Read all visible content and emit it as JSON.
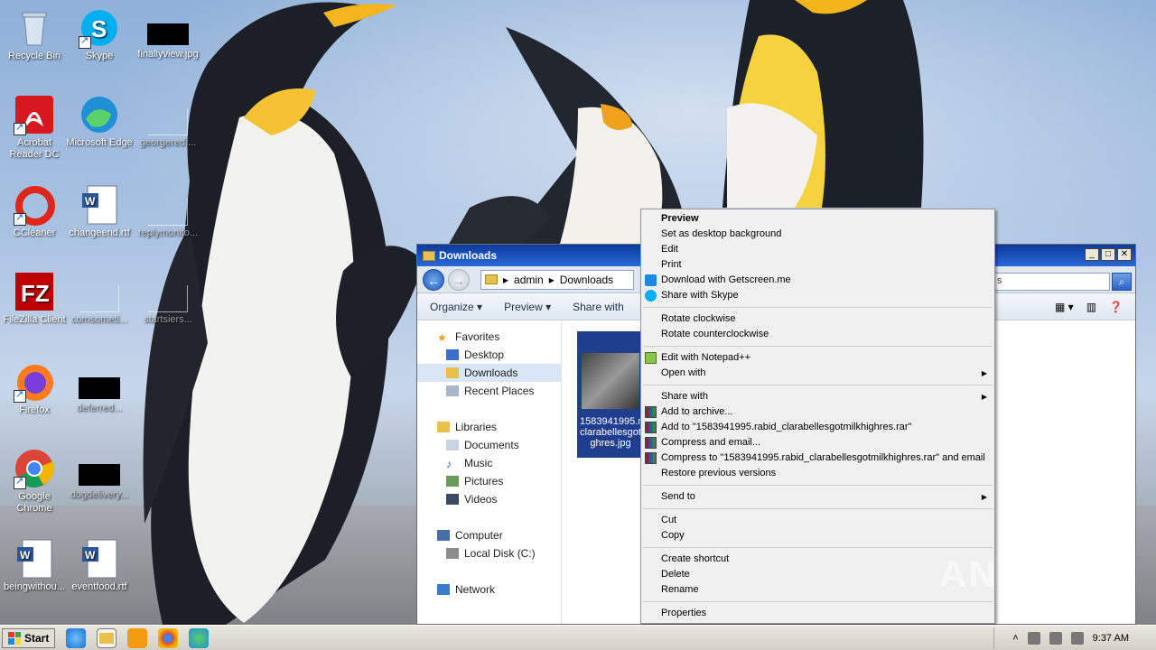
{
  "desktop": {
    "icons": [
      {
        "label": "Recycle Bin"
      },
      {
        "label": "Skype"
      },
      {
        "label": "finallyview.jpg"
      },
      {
        "label": "Acrobat Reader DC"
      },
      {
        "label": "Microsoft Edge"
      },
      {
        "label": "georgered...."
      },
      {
        "label": "CCleaner"
      },
      {
        "label": "changeend.rtf"
      },
      {
        "label": "replymonito..."
      },
      {
        "label": "FileZilla Client"
      },
      {
        "label": "comsometi..."
      },
      {
        "label": "startsiers..."
      },
      {
        "label": "Firefox"
      },
      {
        "label": "deferred..."
      },
      {
        "label": "Google Chrome"
      },
      {
        "label": "dogdelivery..."
      },
      {
        "label": "beingwithou..."
      },
      {
        "label": "eventfood.rtf"
      }
    ]
  },
  "explorer": {
    "title": "Downloads",
    "breadcrumb": [
      "admin",
      "Downloads"
    ],
    "search_value": "s",
    "toolbar": {
      "organize": "Organize",
      "preview": "Preview",
      "share_with": "Share with"
    },
    "nav": {
      "favorites": "Favorites",
      "desktop": "Desktop",
      "downloads": "Downloads",
      "recent": "Recent Places",
      "libraries": "Libraries",
      "documents": "Documents",
      "music": "Music",
      "pictures": "Pictures",
      "videos": "Videos",
      "computer": "Computer",
      "local_disk": "Local Disk (C:)",
      "network": "Network"
    },
    "file": {
      "line1": "1583941995.r",
      "line2": "clarabellesgot",
      "line3": "ghres.jpg"
    }
  },
  "context_menu": {
    "preview": "Preview",
    "set_bg": "Set as desktop background",
    "edit": "Edit",
    "print": "Print",
    "getscreen": "Download with Getscreen.me",
    "skype": "Share with Skype",
    "rotate_cw": "Rotate clockwise",
    "rotate_ccw": "Rotate counterclockwise",
    "notepad": "Edit with Notepad++",
    "open_with": "Open with",
    "share_with": "Share with",
    "add_archive": "Add to archive...",
    "add_rar": "Add to \"1583941995.rabid_clarabellesgotmilkhighres.rar\"",
    "compress_email": "Compress and email...",
    "compress_rar_email": "Compress to \"1583941995.rabid_clarabellesgotmilkhighres.rar\" and email",
    "restore": "Restore previous versions",
    "send_to": "Send to",
    "cut": "Cut",
    "copy": "Copy",
    "create_shortcut": "Create shortcut",
    "delete": "Delete",
    "rename": "Rename",
    "properties": "Properties"
  },
  "watermark": "ANY RUN",
  "taskbar": {
    "start": "Start",
    "time": "9:37 AM"
  }
}
